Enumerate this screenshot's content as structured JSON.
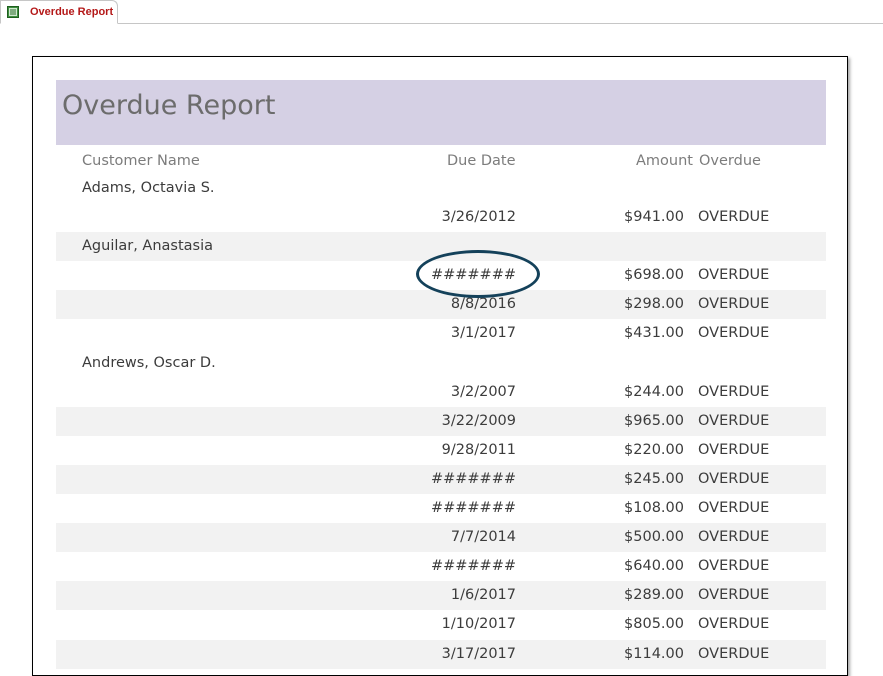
{
  "tab": {
    "label": "Overdue Report",
    "icon": "report-icon"
  },
  "report": {
    "title": "Overdue Report",
    "headers": {
      "customer": "Customer Name",
      "due_date": "Due Date",
      "amount": "Amount",
      "overdue": "Overdue"
    },
    "rows": [
      {
        "name": "Adams, Octavia S.",
        "date": "",
        "amount": "",
        "status": "",
        "shaded": false
      },
      {
        "name": "",
        "date": "3/26/2012",
        "amount": "$941.00",
        "status": "OVERDUE",
        "shaded": false
      },
      {
        "name": "Aguilar, Anastasia",
        "date": "",
        "amount": "",
        "status": "",
        "shaded": true
      },
      {
        "name": "",
        "date": "#######",
        "amount": "$698.00",
        "status": "OVERDUE",
        "shaded": false
      },
      {
        "name": "",
        "date": "8/8/2016",
        "amount": "$298.00",
        "status": "OVERDUE",
        "shaded": true
      },
      {
        "name": "",
        "date": "3/1/2017",
        "amount": "$431.00",
        "status": "OVERDUE",
        "shaded": false
      },
      {
        "name": "Andrews, Oscar D.",
        "date": "",
        "amount": "",
        "status": "",
        "shaded": false
      },
      {
        "name": "",
        "date": "3/2/2007",
        "amount": "$244.00",
        "status": "OVERDUE",
        "shaded": false
      },
      {
        "name": "",
        "date": "3/22/2009",
        "amount": "$965.00",
        "status": "OVERDUE",
        "shaded": true
      },
      {
        "name": "",
        "date": "9/28/2011",
        "amount": "$220.00",
        "status": "OVERDUE",
        "shaded": false
      },
      {
        "name": "",
        "date": "#######",
        "amount": "$245.00",
        "status": "OVERDUE",
        "shaded": true
      },
      {
        "name": "",
        "date": "#######",
        "amount": "$108.00",
        "status": "OVERDUE",
        "shaded": false
      },
      {
        "name": "",
        "date": "7/7/2014",
        "amount": "$500.00",
        "status": "OVERDUE",
        "shaded": true
      },
      {
        "name": "",
        "date": "#######",
        "amount": "$640.00",
        "status": "OVERDUE",
        "shaded": false
      },
      {
        "name": "",
        "date": "1/6/2017",
        "amount": "$289.00",
        "status": "OVERDUE",
        "shaded": true
      },
      {
        "name": "",
        "date": "1/10/2017",
        "amount": "$805.00",
        "status": "OVERDUE",
        "shaded": false
      },
      {
        "name": "",
        "date": "3/17/2017",
        "amount": "$114.00",
        "status": "OVERDUE",
        "shaded": true
      }
    ]
  },
  "annotation": {
    "shape": "ellipse",
    "color": "#14415a"
  },
  "colors": {
    "title_band": "#d5d0e4",
    "tab_text": "#b41818",
    "alt_row": "#f2f2f2"
  }
}
